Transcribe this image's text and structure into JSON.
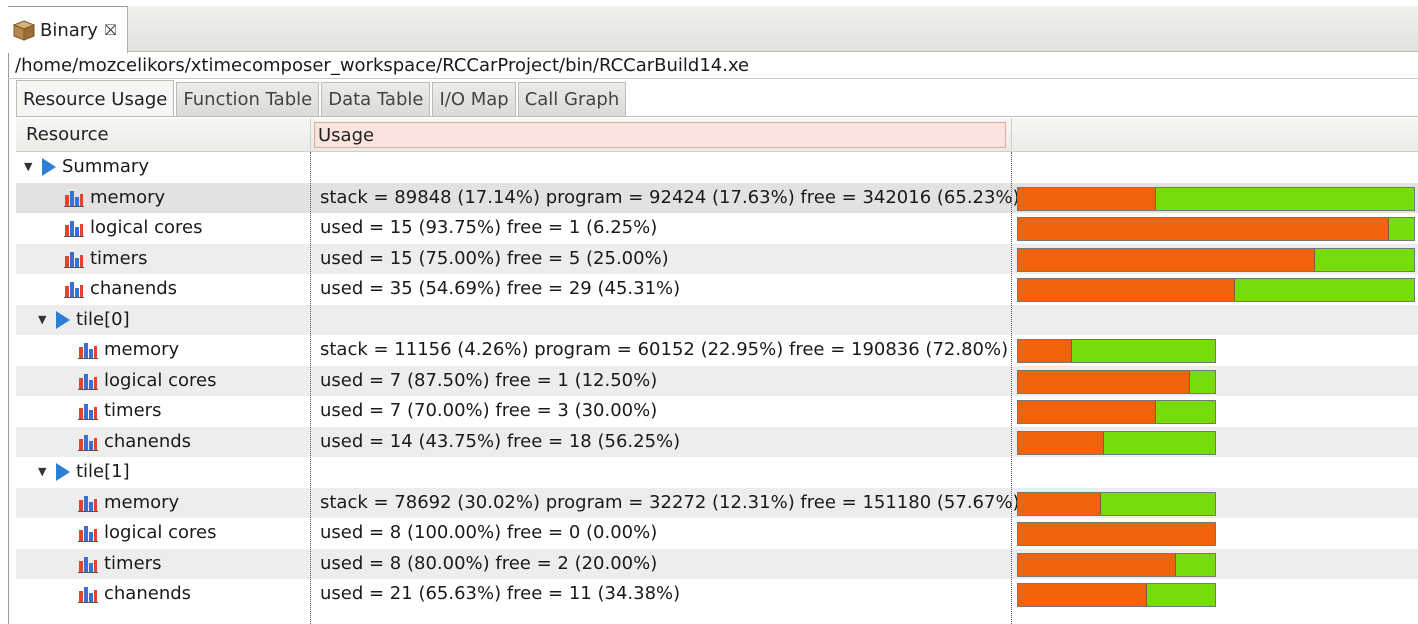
{
  "editor_tab": {
    "label": "Binary",
    "icon": "package-icon",
    "close_icon": "close-icon"
  },
  "path": "/home/mozcelikors/xtimecomposer_workspace/RCCarProject/bin/RCCarBuild14.xe",
  "tabs": [
    {
      "label": "Resource Usage",
      "active": true
    },
    {
      "label": "Function Table",
      "active": false
    },
    {
      "label": "Data Table",
      "active": false
    },
    {
      "label": "I/O Map",
      "active": false
    },
    {
      "label": "Call Graph",
      "active": false
    }
  ],
  "columns": {
    "resource": "Resource",
    "usage": "Usage"
  },
  "colors": {
    "used": "#f2620a",
    "free": "#77dd0a",
    "tree_arrow": "#2e7fd6"
  },
  "rows": [
    {
      "type": "group",
      "label": "Summary",
      "level": 0,
      "expanded": true
    },
    {
      "type": "item",
      "label": "memory",
      "level": 1,
      "usage": "stack = 89848 (17.14%) program = 92424 (17.63%) free = 342016 (65.23%)",
      "used_fraction": 0.3477,
      "selected": true,
      "bar_scale": "wide"
    },
    {
      "type": "item",
      "label": "logical cores",
      "level": 1,
      "usage": "used = 15 (93.75%) free = 1 (6.25%)",
      "used_fraction": 0.9375,
      "bar_scale": "wide"
    },
    {
      "type": "item",
      "label": "timers",
      "level": 1,
      "usage": "used = 15 (75.00%) free = 5 (25.00%)",
      "used_fraction": 0.75,
      "bar_scale": "wide"
    },
    {
      "type": "item",
      "label": "chanends",
      "level": 1,
      "usage": "used = 35 (54.69%) free = 29 (45.31%)",
      "used_fraction": 0.5469,
      "bar_scale": "wide"
    },
    {
      "type": "group",
      "label": "tile[0]",
      "level": 1,
      "expanded": true
    },
    {
      "type": "item",
      "label": "memory",
      "level": 2,
      "usage": "stack = 11156 (4.26%) program = 60152 (22.95%) free = 190836 (72.80%)",
      "used_fraction": 0.2721,
      "bar_scale": "narrow"
    },
    {
      "type": "item",
      "label": "logical cores",
      "level": 2,
      "usage": "used = 7 (87.50%) free = 1 (12.50%)",
      "used_fraction": 0.875,
      "bar_scale": "narrow"
    },
    {
      "type": "item",
      "label": "timers",
      "level": 2,
      "usage": "used = 7 (70.00%) free = 3 (30.00%)",
      "used_fraction": 0.7,
      "bar_scale": "narrow"
    },
    {
      "type": "item",
      "label": "chanends",
      "level": 2,
      "usage": "used = 14 (43.75%) free = 18 (56.25%)",
      "used_fraction": 0.4375,
      "bar_scale": "narrow"
    },
    {
      "type": "group",
      "label": "tile[1]",
      "level": 1,
      "expanded": true
    },
    {
      "type": "item",
      "label": "memory",
      "level": 2,
      "usage": "stack = 78692 (30.02%) program = 32272 (12.31%) free = 151180 (57.67%)",
      "used_fraction": 0.4233,
      "bar_scale": "narrow"
    },
    {
      "type": "item",
      "label": "logical cores",
      "level": 2,
      "usage": "used = 8 (100.00%) free = 0 (0.00%)",
      "used_fraction": 1.0,
      "bar_scale": "narrow"
    },
    {
      "type": "item",
      "label": "timers",
      "level": 2,
      "usage": "used = 8 (80.00%) free = 2 (20.00%)",
      "used_fraction": 0.8,
      "bar_scale": "narrow"
    },
    {
      "type": "item",
      "label": "chanends",
      "level": 2,
      "usage": "used = 21 (65.63%) free = 11 (34.38%)",
      "used_fraction": 0.6563,
      "bar_scale": "narrow"
    }
  ]
}
